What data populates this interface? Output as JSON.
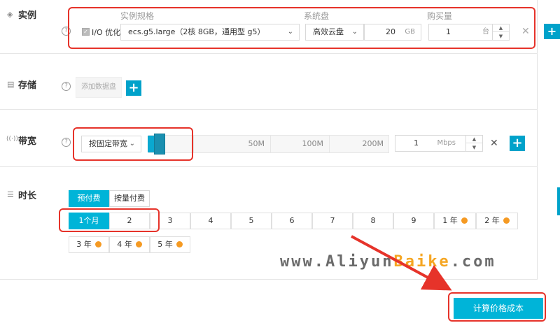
{
  "instance": {
    "title": "实例",
    "help": "?",
    "io_opt_label": "I/O 优化",
    "col_spec": "实例规格",
    "col_disk": "系统盘",
    "col_qty": "购买量",
    "spec_value": "ecs.g5.large（2核 8GB，通用型 g5）",
    "disk_type": "高效云盘",
    "disk_size": "20",
    "disk_unit": "GB",
    "qty_value": "1",
    "qty_unit": "台",
    "close": "✕",
    "plus": "+"
  },
  "storage": {
    "title": "存储",
    "help": "?",
    "add_disk_label": "添加数据盘",
    "plus": "+"
  },
  "bandwidth": {
    "title": "带宽",
    "help": "?",
    "mode": "按固定带宽",
    "ticks": [
      "50M",
      "100M",
      "200M"
    ],
    "value": "1",
    "unit": "Mbps",
    "close": "✕",
    "plus": "+"
  },
  "duration": {
    "title": "时长",
    "tabs": [
      "预付费",
      "按量付费"
    ],
    "row1": [
      "1个月",
      "2",
      "3",
      "4",
      "5",
      "6",
      "7",
      "8",
      "9",
      "1 年",
      "2 年"
    ],
    "row2": [
      "3 年",
      "4 年",
      "5 年"
    ]
  },
  "watermark": {
    "pre": "www.Aliyun",
    "hl": "Baike",
    "post": ".com"
  },
  "calc_button": "计算价格成本",
  "side_plus": "+",
  "colors": {
    "accent": "#00b4d8",
    "highlight": "#e6332a",
    "badge": "#f59a23"
  }
}
